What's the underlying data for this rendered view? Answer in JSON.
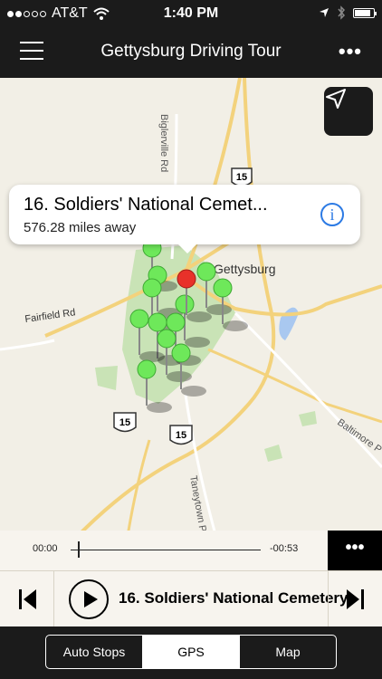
{
  "status_bar": {
    "carrier": "AT&T",
    "time": "1:40 PM",
    "battery_level": 0.85
  },
  "nav": {
    "title": "Gettysburg Driving Tour",
    "menu_icon": "hamburger-menu-icon",
    "more_icon": "more-dots-icon"
  },
  "map": {
    "labels": {
      "town": "Gettysburg",
      "road_fairfield": "Fairfield Rd",
      "road_biglerville": "Biglerville Rd",
      "road_baltimore": "Baltimore P",
      "road_taneytown": "Taneytown P",
      "shield_15_top": "15",
      "shield_15_mid": "15",
      "shield_15_bottom": "15"
    },
    "colors": {
      "pin_green": "#6ee85a",
      "pin_red": "#e8312a",
      "park": "#c9e3b6",
      "water": "#a9c8f0",
      "road": "#f3d27c"
    }
  },
  "callout": {
    "title": "16. Soldiers' National Cemet...",
    "distance": "576.28 miles away",
    "info_icon": "info-icon"
  },
  "player": {
    "elapsed": "00:00",
    "remaining": "-00:53",
    "title": "16. Soldiers' National Cemetery",
    "progress": 0.02
  },
  "tabs": [
    {
      "label": "Auto Stops",
      "active": false
    },
    {
      "label": "GPS",
      "active": true
    },
    {
      "label": "Map",
      "active": false
    }
  ]
}
